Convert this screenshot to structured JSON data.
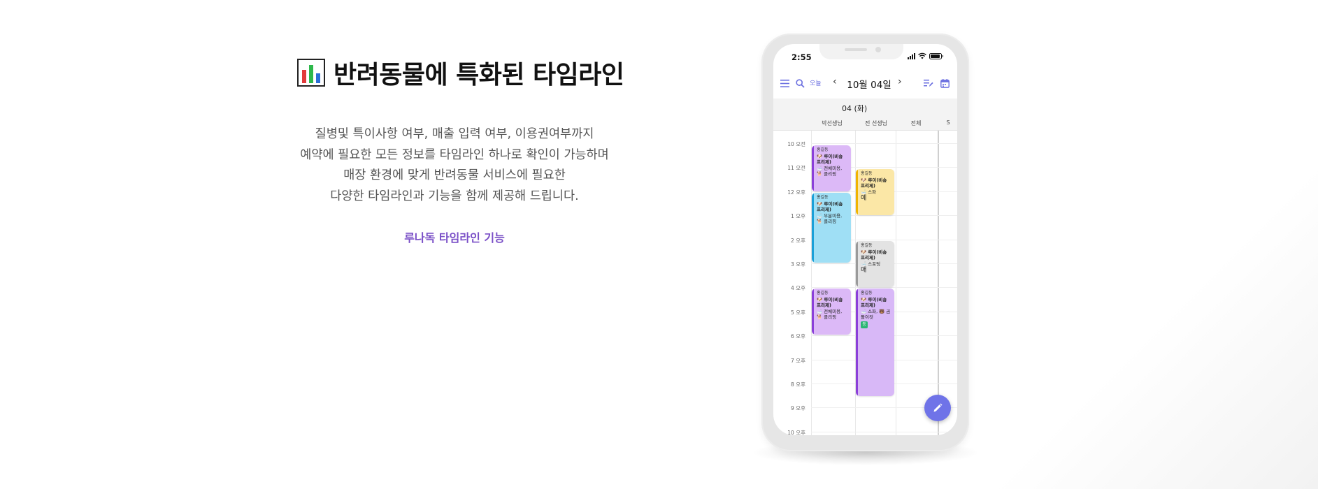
{
  "headline": {
    "title": "반려동물에 특화된 타임라인",
    "icon": "bar-chart-icon"
  },
  "description": {
    "lines": [
      "질병및 특이사항 여부, 매출 입력 여부, 이용권여부까지",
      "예약에 필요한 모든 정보를 타임라인 하나로 확인이 가능하며",
      "매장 환경에 맞게 반려동물 서비스에 필요한",
      "다양한 타임라인과 기능을 함께 제공해 드립니다."
    ]
  },
  "feature_link": "루나독 타임라인 기능",
  "phone": {
    "status": {
      "time": "2:55"
    },
    "toolbar": {
      "today": "오늘",
      "date": "10월 04일",
      "prev": "‹",
      "next": "›"
    },
    "day_header": "04 (화)",
    "columns": [
      "박선생님",
      "전 선생님",
      "전체",
      "S"
    ],
    "hours": [
      "10 오전",
      "11 오전",
      "12 오후",
      "1 오후",
      "2 오후",
      "3 오후",
      "4 오후",
      "5 오후",
      "6 오후",
      "7 오후",
      "8 오후",
      "9 오후",
      "10 오후"
    ],
    "events": [
      {
        "owner": "홍길동",
        "pet": "🐶 루이(비숑 프리제)",
        "services": [
          "🛁 전체미용,",
          "🐕 클리핑"
        ],
        "badge": "",
        "bg": "#dcb9f7",
        "bar": "#8b3fd9"
      },
      {
        "owner": "홍길동",
        "pet": "🐶 루이(비숑 프리제)",
        "services": [
          "🛁 부분미용,",
          "🐕 클리핑"
        ],
        "badge": "",
        "bg": "#9fdff5",
        "bar": "#1aa0d8"
      },
      {
        "owner": "홍길동",
        "pet": "🐶 루이(비숑 프리제)",
        "services": [
          "🛁 전체미용,",
          "🐕 클리핑"
        ],
        "badge": "",
        "bg": "#dcb9f7",
        "bar": "#8b3fd9"
      },
      {
        "owner": "홍길동",
        "pet": "🐶 루이(비숑 프리제)",
        "services": [
          "🛁 스파"
        ],
        "badge": "예",
        "bg": "#fbe7a6",
        "bar": "#f0b400"
      },
      {
        "owner": "홍길동",
        "pet": "🐶 루이(비숑 프리제)",
        "services": [
          "🛁 스포팅"
        ],
        "badge": "매",
        "bg": "#e3e3e3",
        "bar": "#9a9a9a"
      },
      {
        "owner": "홍길동",
        "pet": "🐶 루이(비숑 프리제)",
        "services": [
          "🛁 스파, 🐻 곰돌이컷"
        ],
        "badge": "등",
        "bg": "#d8b8f7",
        "bar": "#8b3fd9"
      }
    ]
  },
  "colors": {
    "accent": "#6f73e8",
    "link": "#7a4fc7"
  }
}
